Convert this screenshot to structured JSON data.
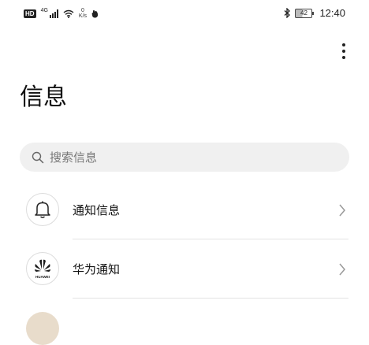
{
  "status_bar": {
    "left": {
      "hd": "HD",
      "network": "4G",
      "speed_value": "0",
      "speed_unit": "K/s"
    },
    "right": {
      "battery": "42",
      "time": "12:40"
    }
  },
  "header": {
    "title": "信息"
  },
  "search": {
    "placeholder": "搜索信息"
  },
  "list": {
    "items": [
      {
        "label": "通知信息",
        "icon": "bell-icon"
      },
      {
        "label": "华为通知",
        "icon": "huawei-logo-icon",
        "logo_text": "HUAWEI"
      }
    ]
  },
  "colors": {
    "background": "#ffffff",
    "search_background": "#f0f0f0",
    "divider": "#e3e3e3",
    "text_primary": "#111111",
    "text_placeholder": "#777777",
    "chevron": "#999999",
    "huawei_logo": "#1a1a1a"
  }
}
